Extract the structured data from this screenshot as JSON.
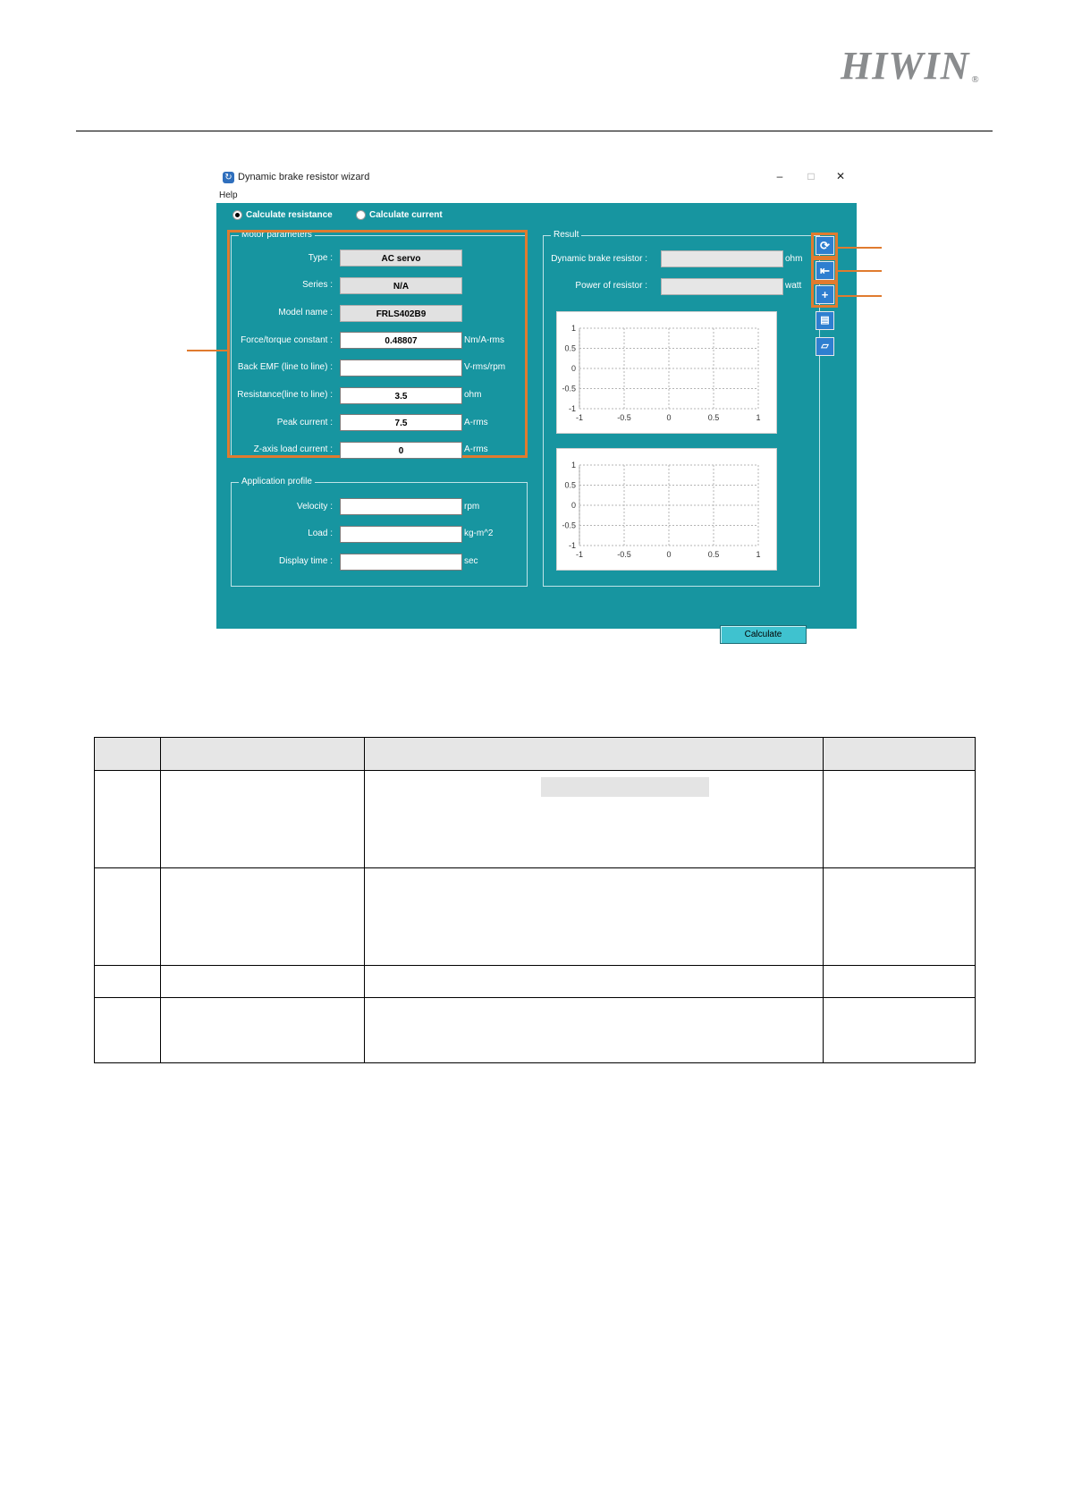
{
  "header": {
    "logo_text": "HIWIN",
    "logo_mark": "®"
  },
  "window": {
    "title": "Dynamic brake resistor wizard",
    "controls": {
      "minimize": "–",
      "maximize": "□",
      "close": "✕"
    },
    "menu": {
      "help": "Help"
    },
    "mode": {
      "calculate_resistance": "Calculate resistance",
      "calculate_current": "Calculate current",
      "selected": "calculate_resistance"
    },
    "motor_parameters": {
      "label": "Motor parameters",
      "type": {
        "label": "Type :",
        "value": "AC servo"
      },
      "series": {
        "label": "Series :",
        "value": "N/A"
      },
      "model_name": {
        "label": "Model name :",
        "value": "FRLS402B9"
      },
      "force_constant": {
        "label": "Force/torque constant :",
        "value": "0.48807",
        "unit": "Nm/A-rms"
      },
      "back_emf": {
        "label": "Back EMF (line to line) :",
        "value": "",
        "unit": "V-rms/rpm"
      },
      "resistance": {
        "label": "Resistance(line to line) :",
        "value": "3.5",
        "unit": "ohm"
      },
      "peak_current": {
        "label": "Peak current :",
        "value": "7.5",
        "unit": "A-rms"
      },
      "z_axis_load_current": {
        "label": "Z-axis load current :",
        "value": "0",
        "unit": "A-rms"
      }
    },
    "application_profile": {
      "label": "Application profile",
      "velocity": {
        "label": "Velocity :",
        "value": "",
        "unit": "rpm"
      },
      "load": {
        "label": "Load :",
        "value": "",
        "unit": "kg-m^2"
      },
      "display_time": {
        "label": "Display time :",
        "value": "",
        "unit": "sec"
      }
    },
    "result": {
      "label": "Result",
      "dynamic_brake_resistor": {
        "label": "Dynamic brake resistor :",
        "value": "",
        "unit": "ohm"
      },
      "power_of_resistor": {
        "label": "Power of resistor :",
        "value": "",
        "unit": "watt"
      }
    },
    "side_buttons": [
      "refresh-icon",
      "import-icon",
      "add-icon",
      "save-icon",
      "open-folder-icon"
    ],
    "calculate_button": "Calculate"
  },
  "plot_ticks": {
    "x": [
      "-1",
      "-0.5",
      "0",
      "0.5",
      "1"
    ],
    "y": [
      "1",
      "0.5",
      "0",
      "-0.5",
      "-1"
    ]
  },
  "colors": {
    "panel": "#1795a0",
    "accent_orange": "#e07b2f",
    "button_blue": "#2e7fd0"
  }
}
